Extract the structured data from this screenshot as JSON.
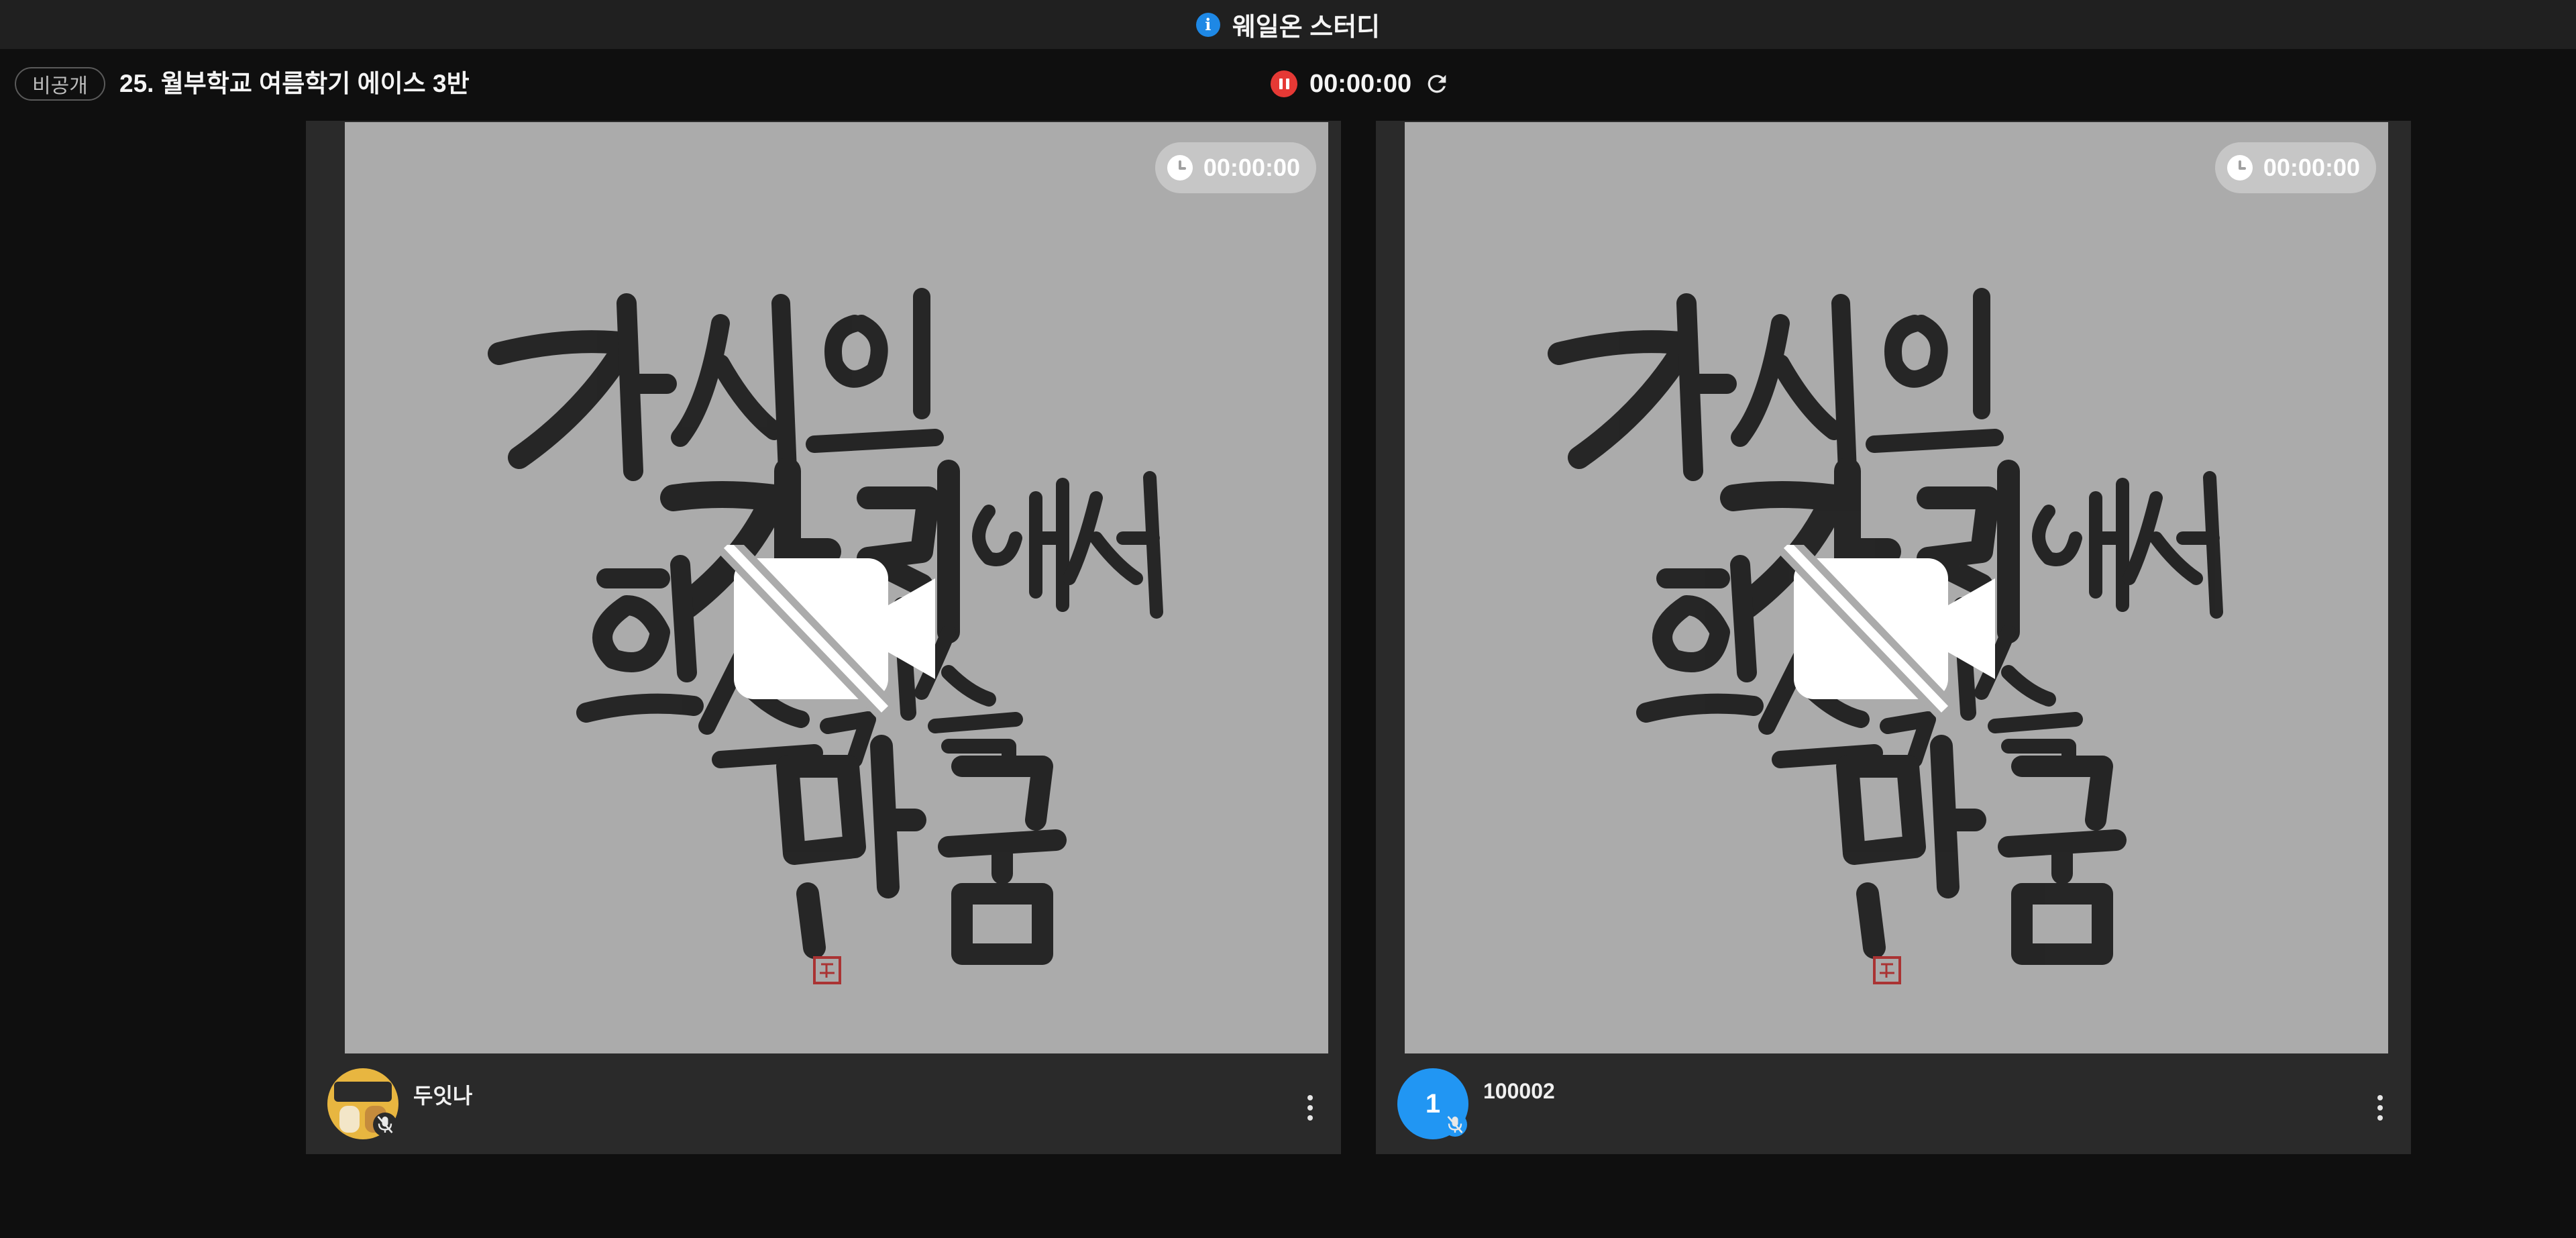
{
  "window": {
    "title": "웨일온 스터디"
  },
  "header": {
    "visibility_badge": "비공개",
    "room_title": "25. 월부학교 여름학기 에이스 3반",
    "recording_timer": "00:00:00"
  },
  "tiles": [
    {
      "timer": "00:00:00",
      "participant_name": "두잇나",
      "avatar_type": "photo",
      "mic": "off",
      "camera": "off"
    },
    {
      "timer": "00:00:00",
      "participant_name": "100002",
      "avatar_type": "number",
      "avatar_label": "1",
      "mic": "off",
      "camera": "off"
    }
  ],
  "colors": {
    "accent": "#2196f3",
    "recording": "#e53935",
    "tile_bg": "#2a2a2a",
    "video_bg": "#ababab"
  },
  "icons": [
    "info-icon",
    "pause-icon",
    "refresh-icon",
    "clock-icon",
    "camera-off-icon",
    "mic-off-icon",
    "more-vert-icon"
  ]
}
